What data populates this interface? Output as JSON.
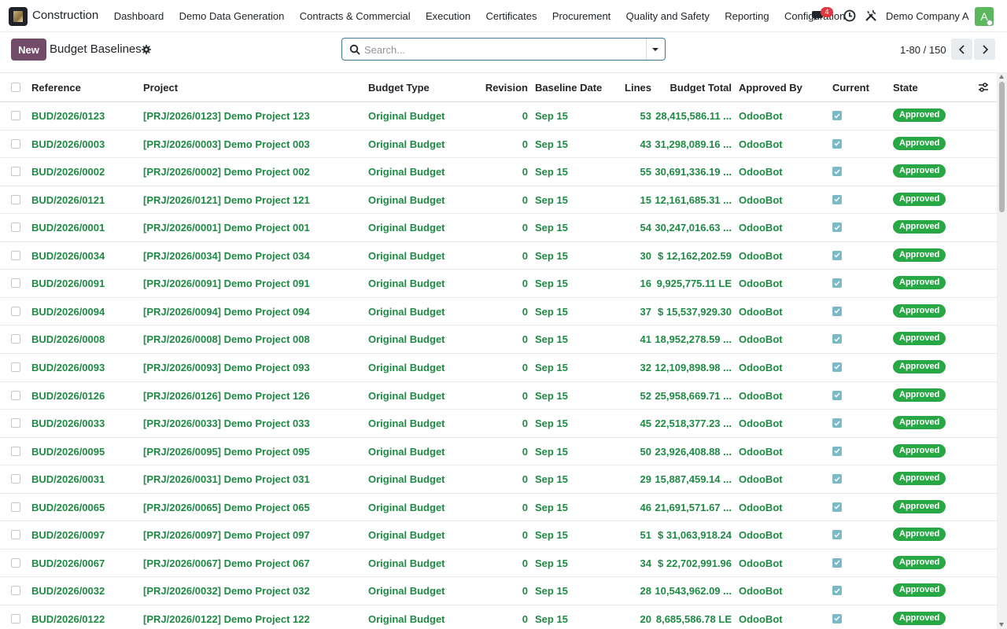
{
  "navbar": {
    "app_name": "Construction",
    "menu": [
      "Dashboard",
      "Demo Data Generation",
      "Contracts & Commercial",
      "Execution",
      "Certificates",
      "Procurement",
      "Quality and Safety",
      "Reporting",
      "Configuration"
    ],
    "chat_badge": "4",
    "company": "Demo Company A",
    "avatar_letter": "A"
  },
  "control": {
    "new_label": "New",
    "title": "Budget Baselines",
    "search_placeholder": "Search...",
    "pager": "1-80 / 150"
  },
  "table": {
    "columns": {
      "reference": "Reference",
      "project": "Project",
      "budget_type": "Budget Type",
      "revision": "Revision",
      "baseline_date": "Baseline Date",
      "lines": "Lines",
      "budget_total": "Budget Total",
      "approved_by": "Approved By",
      "current": "Current",
      "state": "State"
    },
    "rows": [
      {
        "ref": "BUD/2026/0123",
        "project": "[PRJ/2026/0123] Demo Project 123",
        "type": "Original Budget",
        "rev": "0",
        "date": "Sep 15",
        "lines": "53",
        "total": "28,415,586.11 ...",
        "by": "OdooBot",
        "current": true,
        "state": "Approved"
      },
      {
        "ref": "BUD/2026/0003",
        "project": "[PRJ/2026/0003] Demo Project 003",
        "type": "Original Budget",
        "rev": "0",
        "date": "Sep 15",
        "lines": "43",
        "total": "31,298,089.16 ...",
        "by": "OdooBot",
        "current": true,
        "state": "Approved"
      },
      {
        "ref": "BUD/2026/0002",
        "project": "[PRJ/2026/0002] Demo Project 002",
        "type": "Original Budget",
        "rev": "0",
        "date": "Sep 15",
        "lines": "55",
        "total": "30,691,336.19 ...",
        "by": "OdooBot",
        "current": true,
        "state": "Approved"
      },
      {
        "ref": "BUD/2026/0121",
        "project": "[PRJ/2026/0121] Demo Project 121",
        "type": "Original Budget",
        "rev": "0",
        "date": "Sep 15",
        "lines": "15",
        "total": "12,161,685.31 ...",
        "by": "OdooBot",
        "current": true,
        "state": "Approved"
      },
      {
        "ref": "BUD/2026/0001",
        "project": "[PRJ/2026/0001] Demo Project 001",
        "type": "Original Budget",
        "rev": "0",
        "date": "Sep 15",
        "lines": "54",
        "total": "30,247,016.63 ...",
        "by": "OdooBot",
        "current": true,
        "state": "Approved"
      },
      {
        "ref": "BUD/2026/0034",
        "project": "[PRJ/2026/0034] Demo Project 034",
        "type": "Original Budget",
        "rev": "0",
        "date": "Sep 15",
        "lines": "30",
        "total": "$ 12,162,202.59",
        "by": "OdooBot",
        "current": true,
        "state": "Approved"
      },
      {
        "ref": "BUD/2026/0091",
        "project": "[PRJ/2026/0091] Demo Project 091",
        "type": "Original Budget",
        "rev": "0",
        "date": "Sep 15",
        "lines": "16",
        "total": "9,925,775.11 LE",
        "by": "OdooBot",
        "current": true,
        "state": "Approved"
      },
      {
        "ref": "BUD/2026/0094",
        "project": "[PRJ/2026/0094] Demo Project 094",
        "type": "Original Budget",
        "rev": "0",
        "date": "Sep 15",
        "lines": "37",
        "total": "$ 15,537,929.30",
        "by": "OdooBot",
        "current": true,
        "state": "Approved"
      },
      {
        "ref": "BUD/2026/0008",
        "project": "[PRJ/2026/0008] Demo Project 008",
        "type": "Original Budget",
        "rev": "0",
        "date": "Sep 15",
        "lines": "41",
        "total": "18,952,278.59 ...",
        "by": "OdooBot",
        "current": true,
        "state": "Approved"
      },
      {
        "ref": "BUD/2026/0093",
        "project": "[PRJ/2026/0093] Demo Project 093",
        "type": "Original Budget",
        "rev": "0",
        "date": "Sep 15",
        "lines": "32",
        "total": "12,109,898.98 ...",
        "by": "OdooBot",
        "current": true,
        "state": "Approved"
      },
      {
        "ref": "BUD/2026/0126",
        "project": "[PRJ/2026/0126] Demo Project 126",
        "type": "Original Budget",
        "rev": "0",
        "date": "Sep 15",
        "lines": "52",
        "total": "25,958,669.71 ...",
        "by": "OdooBot",
        "current": true,
        "state": "Approved"
      },
      {
        "ref": "BUD/2026/0033",
        "project": "[PRJ/2026/0033] Demo Project 033",
        "type": "Original Budget",
        "rev": "0",
        "date": "Sep 15",
        "lines": "45",
        "total": "22,518,377.23 ...",
        "by": "OdooBot",
        "current": true,
        "state": "Approved"
      },
      {
        "ref": "BUD/2026/0095",
        "project": "[PRJ/2026/0095] Demo Project 095",
        "type": "Original Budget",
        "rev": "0",
        "date": "Sep 15",
        "lines": "50",
        "total": "23,926,408.88 ...",
        "by": "OdooBot",
        "current": true,
        "state": "Approved"
      },
      {
        "ref": "BUD/2026/0031",
        "project": "[PRJ/2026/0031] Demo Project 031",
        "type": "Original Budget",
        "rev": "0",
        "date": "Sep 15",
        "lines": "29",
        "total": "15,887,459.14 ...",
        "by": "OdooBot",
        "current": true,
        "state": "Approved"
      },
      {
        "ref": "BUD/2026/0065",
        "project": "[PRJ/2026/0065] Demo Project 065",
        "type": "Original Budget",
        "rev": "0",
        "date": "Sep 15",
        "lines": "46",
        "total": "21,691,571.67 ...",
        "by": "OdooBot",
        "current": true,
        "state": "Approved"
      },
      {
        "ref": "BUD/2026/0097",
        "project": "[PRJ/2026/0097] Demo Project 097",
        "type": "Original Budget",
        "rev": "0",
        "date": "Sep 15",
        "lines": "51",
        "total": "$ 31,063,918.24",
        "by": "OdooBot",
        "current": true,
        "state": "Approved"
      },
      {
        "ref": "BUD/2026/0067",
        "project": "[PRJ/2026/0067] Demo Project 067",
        "type": "Original Budget",
        "rev": "0",
        "date": "Sep 15",
        "lines": "34",
        "total": "$ 22,702,991.96",
        "by": "OdooBot",
        "current": true,
        "state": "Approved"
      },
      {
        "ref": "BUD/2026/0032",
        "project": "[PRJ/2026/0032] Demo Project 032",
        "type": "Original Budget",
        "rev": "0",
        "date": "Sep 15",
        "lines": "28",
        "total": "10,543,962.09 ...",
        "by": "OdooBot",
        "current": true,
        "state": "Approved"
      },
      {
        "ref": "BUD/2026/0122",
        "project": "[PRJ/2026/0122] Demo Project 122",
        "type": "Original Budget",
        "rev": "0",
        "date": "Sep 15",
        "lines": "20",
        "total": "8,685,586.78 LE",
        "by": "OdooBot",
        "current": true,
        "state": "Approved"
      }
    ]
  },
  "colors": {
    "brand": "#714b67",
    "link_green": "#1e8a44",
    "approved_badge": "#28a745",
    "checkbox_checked": "#7cb9c7"
  }
}
